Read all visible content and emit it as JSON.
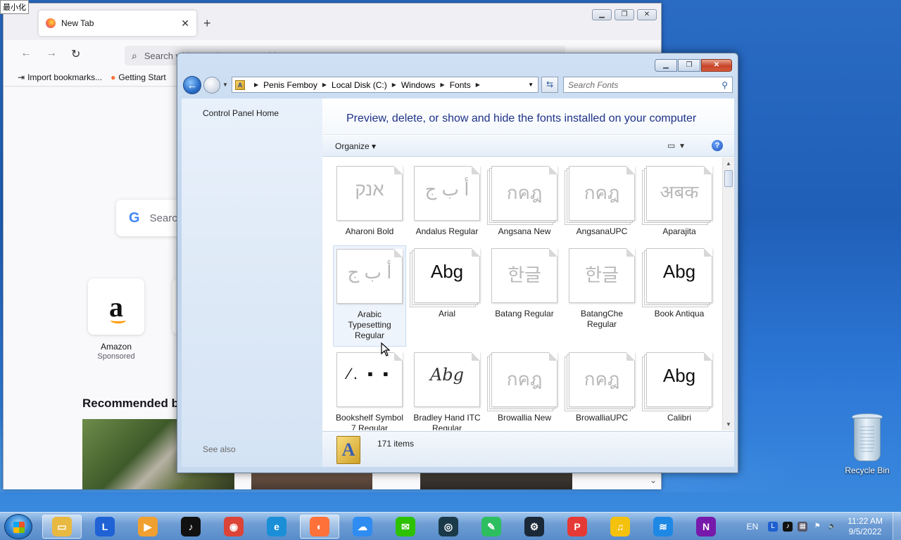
{
  "firefox": {
    "minimize_hint": "最小化",
    "tab_title": "New Tab",
    "url_placeholder": "Search with Google or enter address",
    "bookmarks": [
      "Import bookmarks...",
      "Getting Start"
    ],
    "google_search_placeholder": "Searc",
    "shortcut": {
      "label": "Amazon",
      "sub": "Sponsored"
    },
    "recommended_heading": "Recommended by"
  },
  "explorer": {
    "breadcrumbs": [
      "Penis Femboy",
      "Local Disk (C:)",
      "Windows",
      "Fonts"
    ],
    "search_placeholder": "Search Fonts",
    "left_pane": {
      "home": "Control Panel Home",
      "see_also": "See also"
    },
    "heading": "Preview, delete, or show and hide the fonts installed on your computer",
    "toolbar": {
      "organize": "Organize"
    },
    "fonts": [
      {
        "name": "Aharoni Bold",
        "sample": "אנק",
        "style": "light",
        "stack": false
      },
      {
        "name": "Andalus Regular",
        "sample": "أ ب ج",
        "style": "light",
        "stack": false
      },
      {
        "name": "Angsana New",
        "sample": "กคฎ",
        "style": "light",
        "stack": true
      },
      {
        "name": "AngsanaUPC",
        "sample": "กคฎ",
        "style": "light",
        "stack": true
      },
      {
        "name": "Aparajita",
        "sample": "अबक",
        "style": "light",
        "stack": true
      },
      {
        "name": "Arabic Typesetting Regular",
        "sample": "أ ب ج",
        "style": "light",
        "stack": false,
        "selected": true
      },
      {
        "name": "Arial",
        "sample": "Abg",
        "style": "dark",
        "stack": true
      },
      {
        "name": "Batang Regular",
        "sample": "한글",
        "style": "light",
        "stack": false
      },
      {
        "name": "BatangChe Regular",
        "sample": "한글",
        "style": "light",
        "stack": false
      },
      {
        "name": "Book Antiqua",
        "sample": "Abg",
        "style": "dark",
        "stack": true
      },
      {
        "name": "Bookshelf Symbol 7 Regular",
        "sample": "⁄. ▪ ▪",
        "style": "dots",
        "stack": false
      },
      {
        "name": "Bradley Hand ITC Regular",
        "sample": "Abg",
        "style": "italic",
        "stack": false
      },
      {
        "name": "Browallia New",
        "sample": "กคฎ",
        "style": "light",
        "stack": true
      },
      {
        "name": "BrowalliaUPC",
        "sample": "กคฎ",
        "style": "light",
        "stack": true
      },
      {
        "name": "Calibri",
        "sample": "Abg",
        "style": "dark",
        "stack": true
      }
    ],
    "status": {
      "count": "171 items"
    }
  },
  "desktop": {
    "recycle_bin": "Recycle Bin"
  },
  "taskbar": {
    "apps": [
      "file-explorer",
      "l-app",
      "media-player",
      "tiktok",
      "chrome",
      "edge",
      "firefox",
      "baidu-netdisk",
      "wechat",
      "vpn-client",
      "evernote",
      "steam",
      "pdf-editor",
      "music-app",
      "app-lanes",
      "onenote"
    ],
    "lang": "EN",
    "time": "11:22 AM",
    "date": "9/5/2022"
  }
}
